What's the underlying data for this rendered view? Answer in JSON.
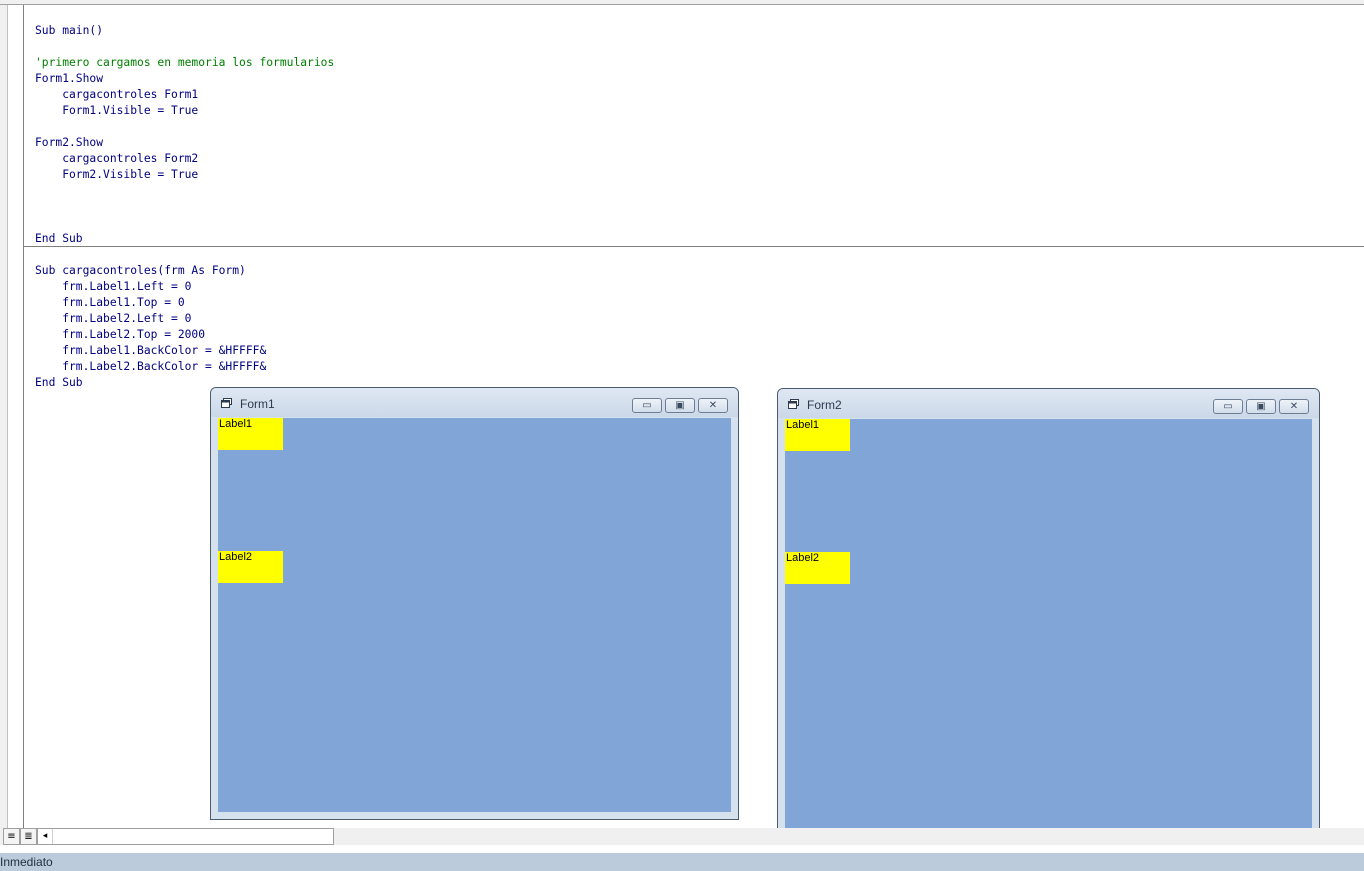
{
  "code_window": {
    "procedure_main": [
      {
        "text": "Sub main()",
        "kind": "code"
      },
      {
        "text": "",
        "kind": "code"
      },
      {
        "text": "'primero cargamos en memoria los formularios",
        "kind": "comment"
      },
      {
        "text": "Form1.Show",
        "kind": "code"
      },
      {
        "text": "    cargacontroles Form1",
        "kind": "code"
      },
      {
        "text": "    Form1.Visible = True",
        "kind": "code"
      },
      {
        "text": "",
        "kind": "code"
      },
      {
        "text": "Form2.Show",
        "kind": "code"
      },
      {
        "text": "    cargacontroles Form2",
        "kind": "code"
      },
      {
        "text": "    Form2.Visible = True",
        "kind": "code"
      },
      {
        "text": "",
        "kind": "code"
      },
      {
        "text": "",
        "kind": "code"
      },
      {
        "text": "",
        "kind": "code"
      },
      {
        "text": "End Sub",
        "kind": "code"
      }
    ],
    "procedure_cargacontroles": [
      {
        "text": "Sub cargacontroles(frm As Form)",
        "kind": "code"
      },
      {
        "text": "    frm.Label1.Left = 0",
        "kind": "code"
      },
      {
        "text": "    frm.Label1.Top = 0",
        "kind": "code"
      },
      {
        "text": "    frm.Label2.Left = 0",
        "kind": "code"
      },
      {
        "text": "    frm.Label2.Top = 2000",
        "kind": "code"
      },
      {
        "text": "    frm.Label1.BackColor = &HFFFF&",
        "kind": "code"
      },
      {
        "text": "    frm.Label2.BackColor = &HFFFF&",
        "kind": "code"
      },
      {
        "text": "End Sub",
        "kind": "code"
      }
    ]
  },
  "forms": [
    {
      "title": "Form1",
      "labels": [
        "Label1",
        "Label2"
      ]
    },
    {
      "title": "Form2",
      "labels": [
        "Label1",
        "Label2"
      ]
    }
  ],
  "titlebar_buttons": {
    "minimize": "▭",
    "maximize": "▣",
    "close": "✕"
  },
  "bottom_bar": {
    "procedure_view_icon": "≡",
    "full_module_view_icon": "≣",
    "scroll_left_icon": "◂"
  },
  "status_bar": {
    "label": "Inmediato"
  },
  "colors": {
    "client_background": "#82a5d8",
    "label_background": "#ffff00",
    "keyword": "#000080",
    "comment": "#008000"
  }
}
